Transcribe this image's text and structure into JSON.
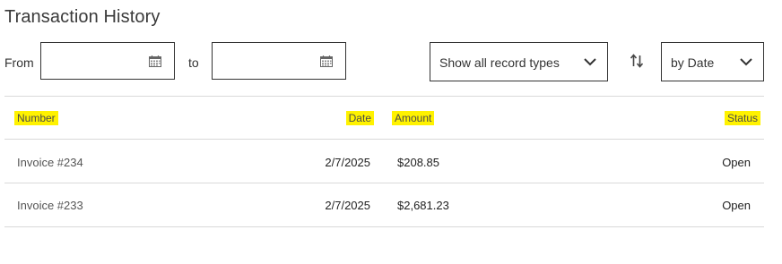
{
  "page": {
    "title": "Transaction History"
  },
  "filters": {
    "from_label": "From",
    "to_label": "to",
    "from_value": "",
    "to_value": "",
    "record_type_selected": "Show all record types",
    "sort_selected": "by Date"
  },
  "table": {
    "columns": [
      "Number",
      "Date",
      "Amount",
      "Status"
    ],
    "rows": [
      {
        "number": "Invoice #234",
        "date": "2/7/2025",
        "amount": "$208.85",
        "status": "Open"
      },
      {
        "number": "Invoice #233",
        "date": "2/7/2025",
        "amount": "$2,681.23",
        "status": "Open"
      }
    ]
  },
  "icons": {
    "calendar": "calendar-icon",
    "chevron": "chevron-down-icon",
    "sort": "sort-direction-icon"
  },
  "colors": {
    "header_highlight": "#fff200",
    "border": "#333333",
    "divider": "#d9d9d9"
  }
}
